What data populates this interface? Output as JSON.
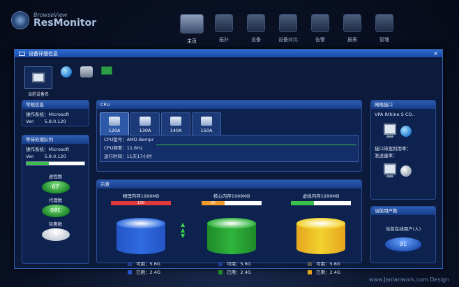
{
  "app": {
    "brand_small": "BrowseView",
    "brand_name": "ResMonitor"
  },
  "nav": [
    {
      "label": "主页",
      "icon": "home-icon"
    },
    {
      "label": "拓扑",
      "icon": "topology-icon"
    },
    {
      "label": "设备",
      "icon": "device-icon"
    },
    {
      "label": "设备对比",
      "icon": "compare-icon"
    },
    {
      "label": "告警",
      "icon": "alarm-icon"
    },
    {
      "label": "报表",
      "icon": "report-icon"
    },
    {
      "label": "管理",
      "icon": "manage-icon"
    }
  ],
  "window": {
    "title": "设备详细信息",
    "close": "×"
  },
  "devices": [
    {
      "label": "当前设备名",
      "icon": "monitor-icon"
    },
    {
      "label": "",
      "icon": "globe-icon"
    },
    {
      "label": "",
      "icon": "film-reel-icon"
    },
    {
      "label": "",
      "icon": "network-card-icon"
    }
  ],
  "general": {
    "title": "常规信息",
    "os": "操作系统：Microsoft",
    "ver": "Ver:",
    "ver_value": "5.8.0.120"
  },
  "queue": {
    "title": "等待处理队列",
    "os": "操作系统：Microsoft",
    "ver": "Ver:",
    "ver_value": "5.8.0.120",
    "progress": 0.38,
    "process_label": "进程数",
    "process_value": "67",
    "agent_label": "代理数",
    "agent_value": "091",
    "package_label": "包裹数",
    "package_value": ""
  },
  "cpu": {
    "title": "CPU",
    "tabs": [
      {
        "label": "120A"
      },
      {
        "label": "130A"
      },
      {
        "label": "140A"
      },
      {
        "label": "150A"
      }
    ],
    "model": "CPU型号：AMD Bempr",
    "freq": "CPU频率：11.6Hz",
    "uptime": "运行时间：11天17小时"
  },
  "memory": {
    "title": "示意",
    "columns": [
      {
        "title": "物理内存1999MB",
        "bar_value": "100",
        "bar_fill": 1.0,
        "bar_color": "#e03a3a",
        "cyl_color": "#2f6ce0",
        "used_color": "#2454c6",
        "avail": "可用：5.6G",
        "used": "已用：2.4G"
      },
      {
        "title": "核心内存1999MB",
        "bar_value": "20",
        "bar_fill": 0.38,
        "bar_color": "#f29a2a",
        "cyl_color": "#2fb43c",
        "used_color": "#1f8a2a",
        "avail": "可用：5.6G",
        "used": "已用：2.4G"
      },
      {
        "title": "虚拟内存1999MB",
        "bar_value": "",
        "bar_fill": 0.38,
        "bar_color": "#3bc24a",
        "cyl_color": "#f2d22e",
        "used_color": "#e6a51f",
        "avail": "可用：5.6G",
        "used": "已用：2.4G"
      }
    ]
  },
  "network": {
    "title": "网络接口",
    "name": "VPA Rthine S CO..",
    "bandwidth": "接口带宽利用率：",
    "speed": "发送速率："
  },
  "users": {
    "title": "当前用户数",
    "online_label": "当前在线用户(人)",
    "online_value": "91"
  },
  "footer": {
    "watermark": "www.Janlanwork.com Design"
  }
}
